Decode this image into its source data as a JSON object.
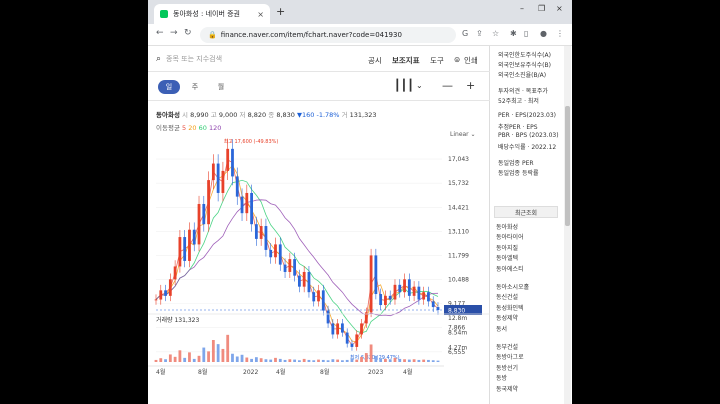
{
  "browser": {
    "tab_title": "동아화성 : 네이버 증권",
    "tab_close": "×",
    "new_tab": "+",
    "url": "finance.naver.com/item/fchart.naver?code=041930",
    "window_controls": [
      "–",
      "❐",
      "×"
    ]
  },
  "toolbar": {
    "search_placeholder": "종목 또는 지수검색",
    "items": [
      "공시",
      "보조지표",
      "도구",
      "인쇄"
    ]
  },
  "periods": [
    "일",
    "주",
    "월"
  ],
  "stock": {
    "name": "동아화성",
    "open_label": "시",
    "open": "8,990",
    "high_label": "고",
    "high": "9,000",
    "low_label": "저",
    "low": "8,820",
    "close_label": "종",
    "close": "8,830",
    "change": "▼160",
    "change_pct": "-1.78%",
    "volume_label": "거",
    "volume": "131,323"
  },
  "ma": {
    "label": "이동평균",
    "periods": [
      "5",
      "20",
      "60",
      "120"
    ]
  },
  "chart_data": {
    "type": "line",
    "title": "",
    "scale": "Linear",
    "x_ticks": [
      "4월",
      "8월",
      "2022",
      "4월",
      "8월",
      "2023",
      "4월"
    ],
    "y_ticks": [
      "17,043",
      "15,732",
      "14,421",
      "13,110",
      "11,799",
      "10,488",
      "9,177",
      "7,866",
      "6,555"
    ],
    "ylim": [
      6000,
      18300
    ],
    "current_price": "8,830",
    "high_annotation": "최고 17,600 (-49.83%)",
    "low_annotation": "최저 6,820 (29.47%)",
    "price_series": [
      9400,
      9900,
      9600,
      10500,
      11200,
      12800,
      11500,
      13200,
      12400,
      14600,
      13500,
      15900,
      16800,
      15200,
      16400,
      17600,
      16100,
      15000,
      14100,
      15200,
      13500,
      12700,
      13400,
      12100,
      11700,
      12400,
      11300,
      10900,
      11600,
      10700,
      10100,
      10900,
      9800,
      9300,
      9900,
      8800,
      8100,
      7500,
      8100,
      7600,
      7000,
      6820,
      7500,
      8100,
      8700,
      11800,
      9700,
      9100,
      9600,
      9400,
      10200,
      9800,
      10500,
      9600,
      10100,
      9400,
      9800,
      9300,
      8990,
      8830
    ],
    "ma_series": [
      {
        "name": "5",
        "color": "#e84c3d"
      },
      {
        "name": "20",
        "color": "#f39c12"
      },
      {
        "name": "60",
        "color": "#2ecc71"
      },
      {
        "name": "120",
        "color": "#8e44ad"
      }
    ],
    "volume_label": "거래량",
    "volume_value": "131,323",
    "volume_ticks": [
      "12.8m",
      "8.54m",
      "4.27m"
    ],
    "volume_series": [
      0.6,
      1.1,
      0.8,
      2.2,
      1.5,
      3.4,
      1.2,
      2.8,
      0.9,
      1.8,
      4.2,
      3.1,
      6.4,
      5.2,
      3.8,
      7.9,
      2.4,
      1.6,
      2.1,
      1.3,
      0.9,
      1.4,
      1.1,
      0.8,
      0.7,
      1.2,
      0.9,
      0.6,
      0.8,
      0.7,
      0.5,
      0.9,
      0.6,
      0.5,
      0.7,
      0.6,
      0.5,
      0.8,
      0.7,
      0.5,
      0.6,
      0.9,
      0.7,
      1.5,
      2.6,
      5.1,
      1.8,
      1.1,
      0.9,
      0.8,
      1.2,
      0.9,
      0.8,
      0.7,
      0.8,
      0.6,
      0.7,
      0.6,
      0.5,
      0.4
    ]
  },
  "sidebar": {
    "info_lines": [
      "외국인한도주식수(A)",
      "외국인보유주식수(B)",
      "외국인소진율(B/A)",
      "투자의견 · 목표주가",
      "52주최고 · 최저",
      "PER · EPS(2023.03)",
      "추정PER · EPS",
      "PBR · BPS (2023.03)",
      "배당수익률 · 2022.12",
      "동일업종 PER",
      "동일업종 등락률"
    ],
    "recent_title": "최근조회",
    "recent": [
      "동아화성",
      "동아타이어",
      "동아지질",
      "동아엘텍",
      "동아에스티",
      "동아소시오홀",
      "동신건설",
      "동성화인텍",
      "동성제약",
      "동서",
      "동부건설",
      "동방아그로",
      "동방선기",
      "동방",
      "동국제약"
    ]
  }
}
